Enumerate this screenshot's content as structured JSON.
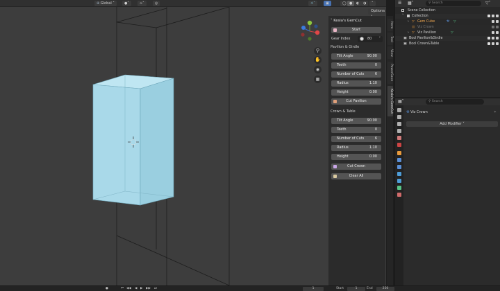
{
  "viewport": {
    "header": {
      "transform_orientation": "Global",
      "options_label": "Options"
    }
  },
  "npanel": {
    "title": "Kesia's GemCut",
    "start_label": "Start",
    "gear_index_label": "Gear Index",
    "gear_index_value": "80",
    "pavilion_section": "Pavilion & Girdle",
    "pavilion_fields": [
      {
        "label": "Tilt Angle",
        "value": "90.00"
      },
      {
        "label": "Teeth",
        "value": "0"
      },
      {
        "label": "Number of Cuts",
        "value": "6"
      },
      {
        "label": "Radius",
        "value": "1.10"
      },
      {
        "label": "Height",
        "value": "0.00"
      }
    ],
    "cut_pavilion_label": "Cut Pavilion",
    "crown_section": "Crown & Table",
    "crown_fields": [
      {
        "label": "Tilt Angle",
        "value": "90.00"
      },
      {
        "label": "Teeth",
        "value": "0"
      },
      {
        "label": "Number of Cuts",
        "value": "6"
      },
      {
        "label": "Radius",
        "value": "1.10"
      },
      {
        "label": "Height",
        "value": "0.00"
      }
    ],
    "cut_crown_label": "Cut Crown",
    "clear_all_label": "Clear All"
  },
  "vtabs": [
    "Item",
    "Tool",
    "View",
    "PowerSave",
    "Kesia's GemCut"
  ],
  "outliner": {
    "search_placeholder": "Search",
    "rows": [
      {
        "label": "Scene Collection"
      },
      {
        "label": "Collection"
      },
      {
        "label": "Gem Cube"
      },
      {
        "label": "Viz Crown"
      },
      {
        "label": "Viz Pavilion"
      },
      {
        "label": "Bool Pavilion&Girdle"
      },
      {
        "label": "Bool Crown&Table"
      }
    ]
  },
  "properties": {
    "search_placeholder": "Search",
    "object_name": "Viz Crown",
    "add_modifier_label": "Add Modifier"
  },
  "statusbar": {
    "current_frame": "1",
    "start_label": "Start",
    "start_value": "1",
    "end_label": "End",
    "end_value": "250"
  },
  "colors": {
    "accent_blue": "#4772b3",
    "cube_fill": "#a8d8e8",
    "modifier_wrench": "#5a8fd6",
    "collection_orange": "#e89a3c",
    "mesh_green": "#58c486"
  }
}
